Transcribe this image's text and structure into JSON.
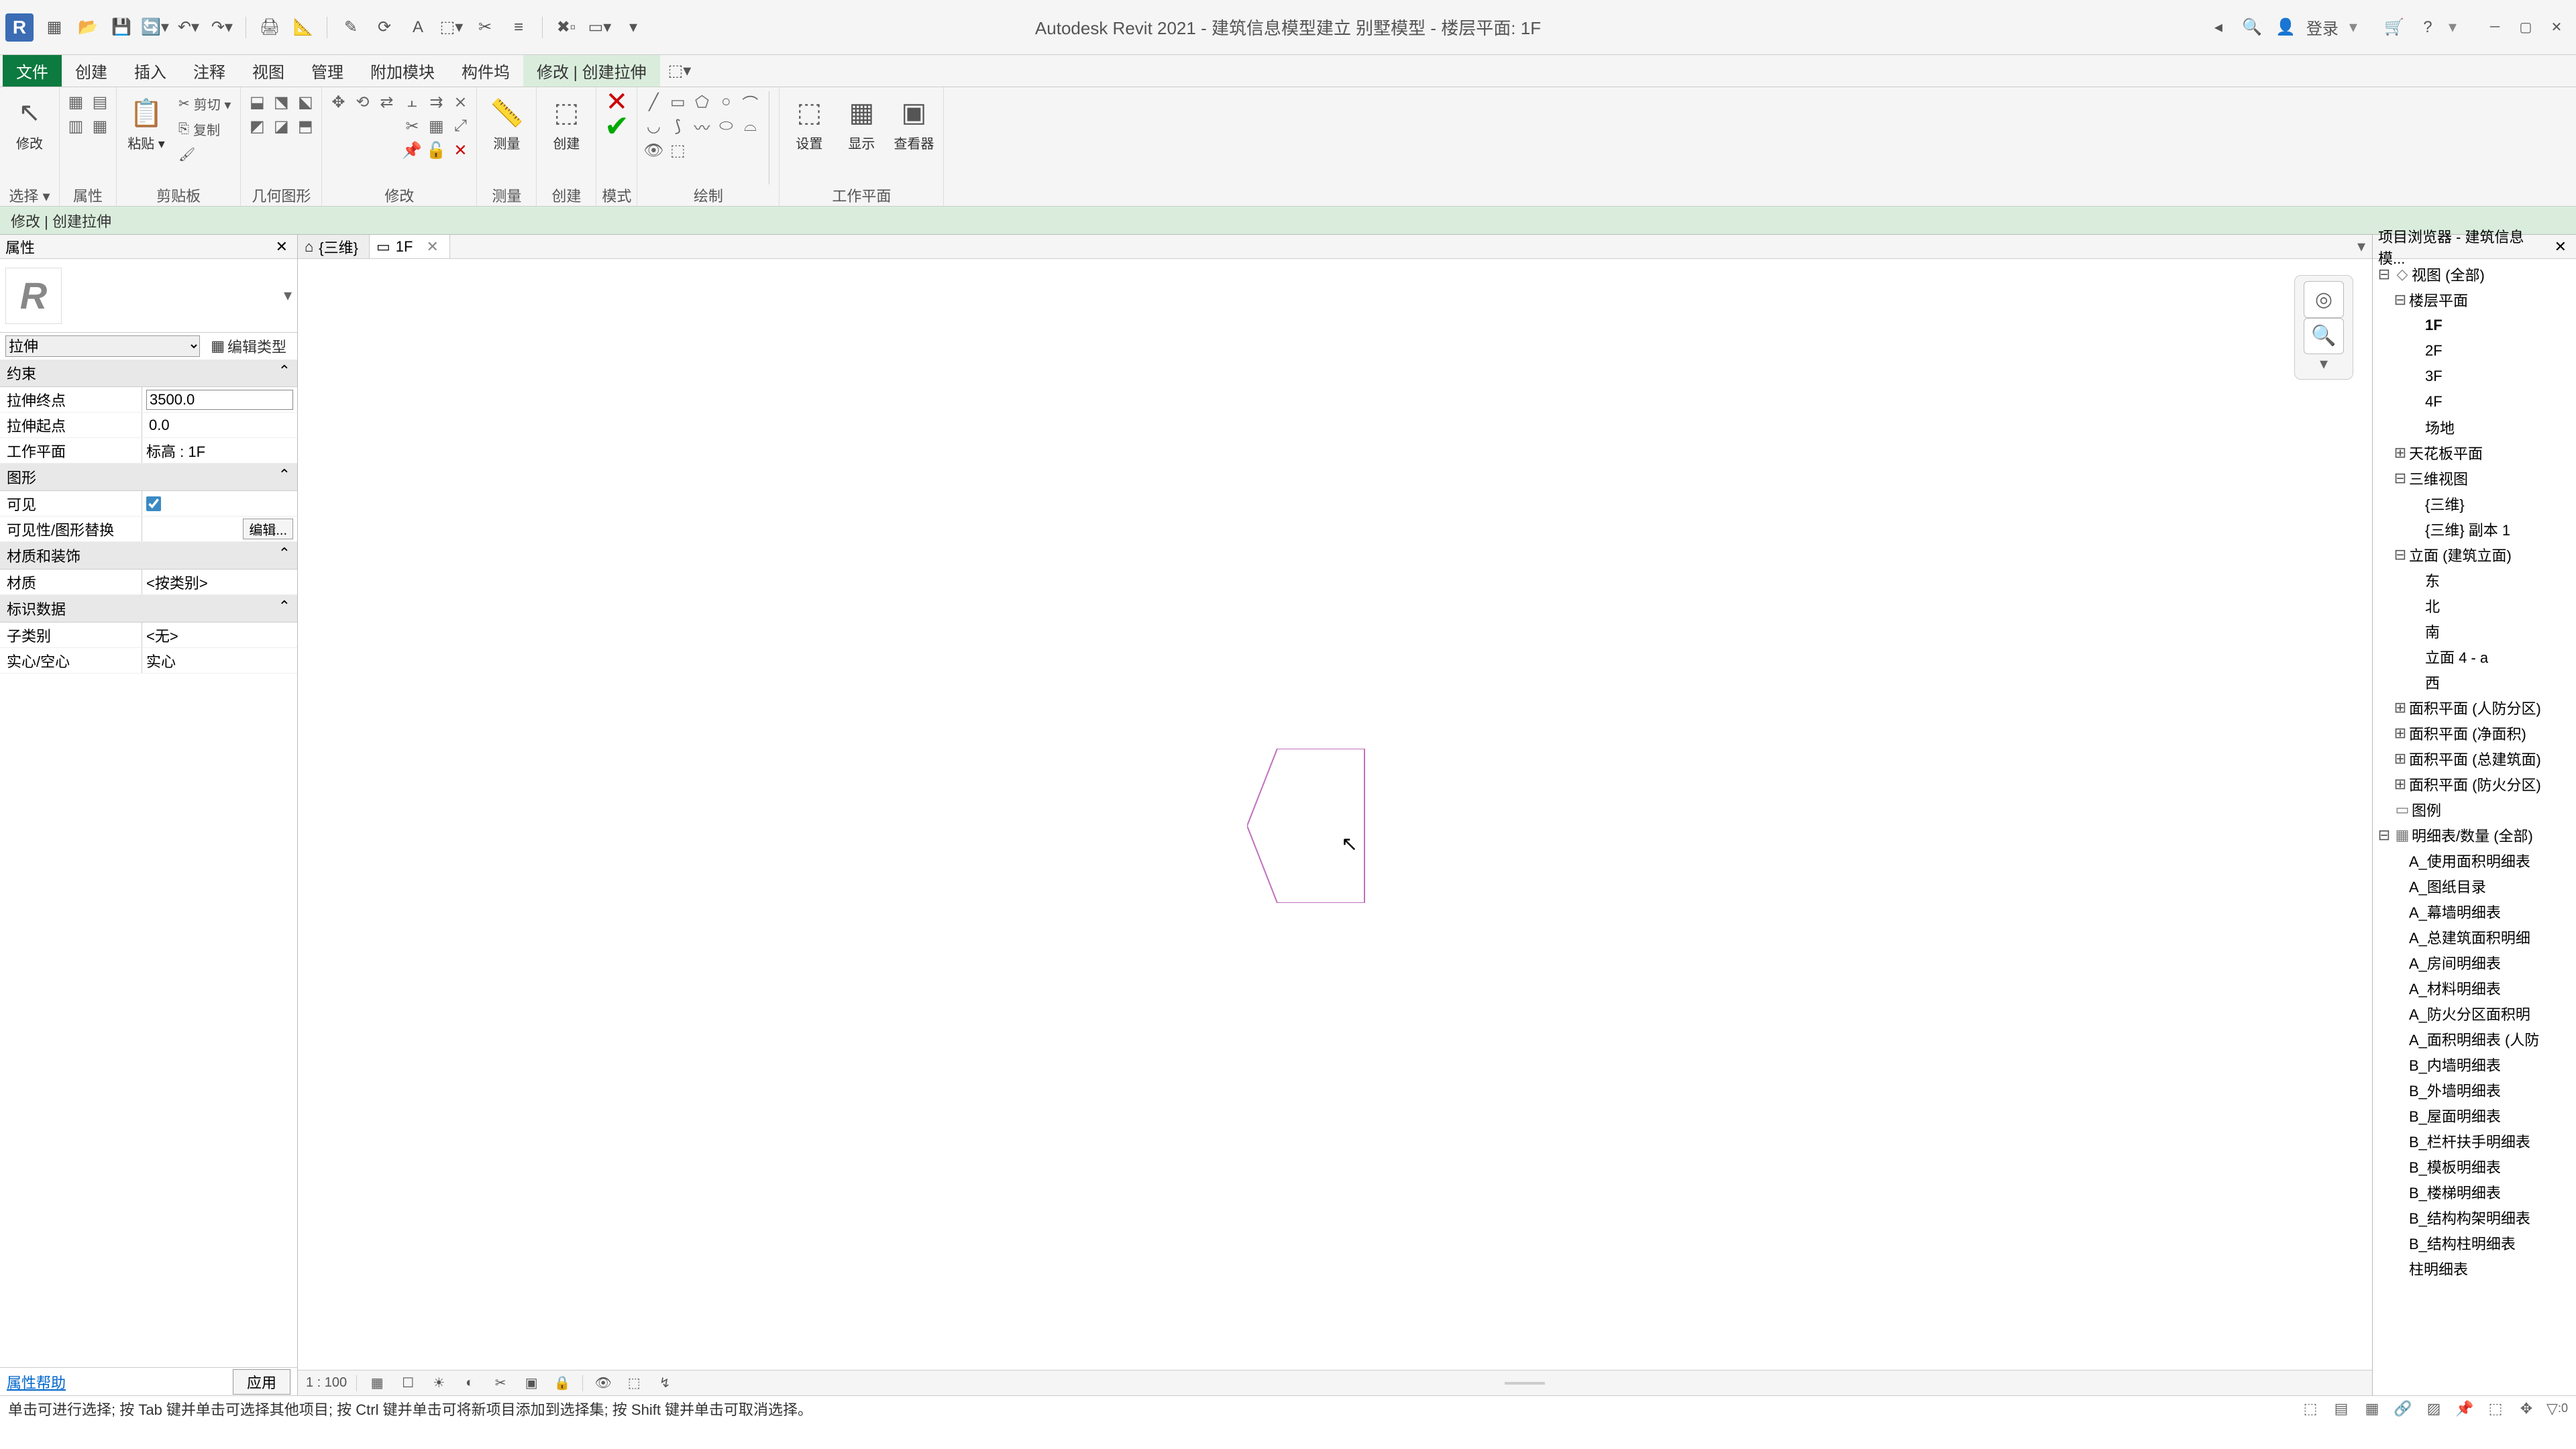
{
  "title": "Autodesk Revit 2021 - 建筑信息模型建立 别墅模型 - 楼层平面: 1F",
  "login": "登录",
  "menus": {
    "file": "文件",
    "create": "创建",
    "insert": "插入",
    "annotate": "注释",
    "view": "视图",
    "manage": "管理",
    "addins": "附加模块",
    "components": "构件坞",
    "modify": "修改 | 创建拉伸"
  },
  "ribbon_sel_label": "选择 ▾",
  "ribbon_panel_labels": {
    "select": "选择",
    "properties": "属性",
    "clipboard": "剪贴板",
    "geometry": "几何图形",
    "modify": "修改",
    "measure": "测量",
    "create": "创建",
    "mode": "模式",
    "draw": "绘制",
    "workplane": "工作平面"
  },
  "ribbon_btns": {
    "modify": "修改",
    "props": "属性",
    "paste": "粘贴 ▾",
    "cut": "剪切 ▾",
    "copy": "复制",
    "measure": "测量",
    "create": "创建",
    "set": "设置",
    "show": "显示",
    "viewer": "查看器"
  },
  "optbar": "修改 | 创建拉伸",
  "prop_title": "属性",
  "type_dropdown": "拉伸",
  "edit_type": "编辑类型",
  "cat_constraints": "约束",
  "p_end": "拉伸终点",
  "v_end": "3500.0",
  "p_start": "拉伸起点",
  "v_start": "0.0",
  "p_wp": "工作平面",
  "v_wp": "标高 : 1F",
  "cat_graphics": "图形",
  "p_vis": "可见",
  "v_vis": true,
  "p_visover": "可见性/图形替换",
  "v_visover": "编辑...",
  "cat_mat": "材质和装饰",
  "p_mat": "材质",
  "v_mat": "<按类别>",
  "cat_id": "标识数据",
  "p_sub": "子类别",
  "v_sub": "<无>",
  "p_solid": "实心/空心",
  "v_solid": "实心",
  "prop_help": "属性帮助",
  "prop_apply": "应用",
  "tab1": "{三维}",
  "tab2": "1F",
  "browser_title": "项目浏览器 - 建筑信息模...",
  "tree": {
    "root": "视图 (全部)",
    "floor": "楼层平面",
    "floors": [
      "1F",
      "2F",
      "3F",
      "4F",
      "场地"
    ],
    "ceiling": "天花板平面",
    "threeD": "三维视图",
    "threeDs": [
      "{三维}",
      "{三维} 副本 1"
    ],
    "elev": "立面 (建筑立面)",
    "elevs": [
      "东",
      "北",
      "南",
      "立面 4 - a",
      "西"
    ],
    "area1": "面积平面 (人防分区)",
    "area2": "面积平面 (净面积)",
    "area3": "面积平面 (总建筑面)",
    "area4": "面积平面 (防火分区)",
    "legend": "图例",
    "sched": "明细表/数量 (全部)",
    "scheds": [
      "A_使用面积明细表",
      "A_图纸目录",
      "A_幕墙明细表",
      "A_总建筑面积明细",
      "A_房间明细表",
      "A_材料明细表",
      "A_防火分区面积明",
      "A_面积明细表 (人防",
      "B_内墙明细表",
      "B_外墙明细表",
      "B_屋面明细表",
      "B_栏杆扶手明细表",
      "B_模板明细表",
      "B_楼梯明细表",
      "B_结构构架明细表",
      "B_结构柱明细表",
      "柱明细表"
    ]
  },
  "scale": "1 : 100",
  "status": "单击可进行选择; 按 Tab 键并单击可选择其他项目; 按 Ctrl 键并单击可将新项目添加到选择集; 按 Shift 键并单击可取消选择。",
  "filter_count": ":0"
}
